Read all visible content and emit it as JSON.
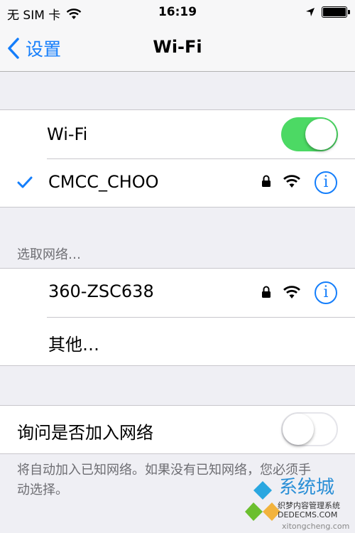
{
  "status_bar": {
    "carrier": "无 SIM 卡",
    "time": "16:19"
  },
  "nav": {
    "back_label": "设置",
    "title": "Wi-Fi"
  },
  "wifi_section": {
    "label": "Wi-Fi",
    "toggle_on": true,
    "connected_network": "CMCC_CHOO"
  },
  "choose_network": {
    "header": "选取网络…",
    "networks": [
      {
        "name": "360-ZSC638",
        "secured": true
      }
    ],
    "other_label": "其他…"
  },
  "ask_join": {
    "label": "询问是否加入网络",
    "toggle_on": false,
    "note": "将自动加入已知网络。如果没有已知网络，您必须手动选择。"
  },
  "watermark": {
    "main": "系统城",
    "sub1": "织梦内容管理系统",
    "sub2": "DEDECMS.COM",
    "sub3": "xitongcheng.com"
  },
  "colors": {
    "accent": "#147efb",
    "switch_on": "#4cd964"
  }
}
